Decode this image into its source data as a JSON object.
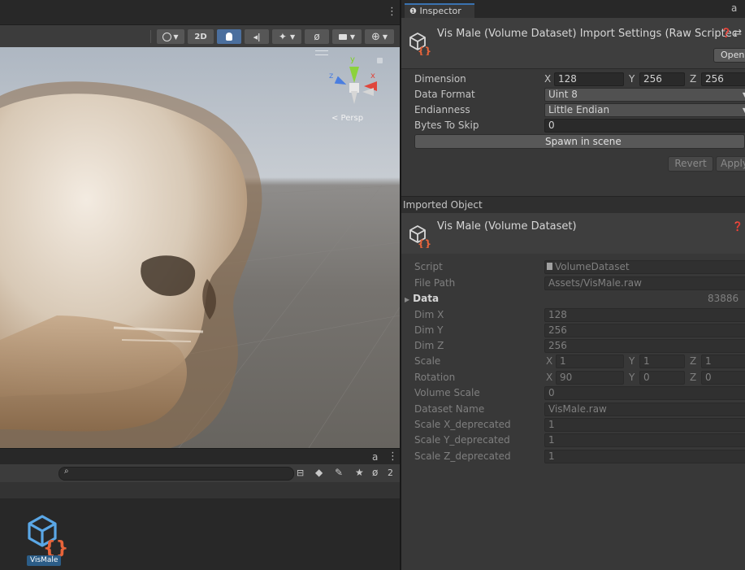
{
  "scene": {
    "toolbar": {
      "mode_2d": "2D"
    },
    "gizmo": {
      "axis_y": "y",
      "axis_z": "z",
      "axis_x": "x",
      "persp": "< Persp"
    }
  },
  "project": {
    "search": {
      "value": ""
    },
    "hidden_count": "2",
    "asset": {
      "name": "VisMale"
    }
  },
  "inspector": {
    "tab_label": "Inspector",
    "header": {
      "title": "Vis Male (Volume Dataset) Import Settings (Raw Scriptec",
      "open_label": "Open"
    },
    "settings": {
      "dimension": {
        "label": "Dimension",
        "x_label": "X",
        "x": "128",
        "y_label": "Y",
        "y": "256",
        "z_label": "Z",
        "z": "256"
      },
      "data_format": {
        "label": "Data Format",
        "value": "Uint 8"
      },
      "endianness": {
        "label": "Endianness",
        "value": "Little Endian"
      },
      "bytes_to_skip": {
        "label": "Bytes To Skip",
        "value": "0"
      },
      "spawn_label": "Spawn in scene",
      "revert_label": "Revert",
      "apply_label": "Apply"
    },
    "imported_header": "Imported Object",
    "object": {
      "title": "Vis Male (Volume Dataset)",
      "props": {
        "script": {
          "label": "Script",
          "value": "VolumeDataset"
        },
        "file_path": {
          "label": "File Path",
          "value": "Assets/VisMale.raw"
        },
        "data": {
          "label": "Data",
          "value": "83886"
        },
        "dim_x": {
          "label": "Dim X",
          "value": "128"
        },
        "dim_y": {
          "label": "Dim Y",
          "value": "256"
        },
        "dim_z": {
          "label": "Dim Z",
          "value": "256"
        },
        "scale": {
          "label": "Scale",
          "x": "1",
          "y": "1",
          "z": "1"
        },
        "rotation": {
          "label": "Rotation",
          "x": "90",
          "y": "0",
          "z": "0"
        },
        "volume_scale": {
          "label": "Volume Scale",
          "value": "0"
        },
        "dataset_name": {
          "label": "Dataset Name",
          "value": "VisMale.raw"
        },
        "scale_x_dep": {
          "label": "Scale X_deprecated",
          "value": "1"
        },
        "scale_y_dep": {
          "label": "Scale Y_deprecated",
          "value": "1"
        },
        "scale_z_dep": {
          "label": "Scale Z_deprecated",
          "value": "1"
        }
      },
      "axis_labels": {
        "x": "X",
        "y": "Y",
        "z": "Z"
      }
    }
  },
  "colors": {
    "accent_blue": "#3a72b0",
    "asset_icon_blue": "#5aa7e6",
    "asset_icon_orange": "#e8643a",
    "gizmo_y": "#8cd23c",
    "gizmo_x": "#e0463c",
    "gizmo_z": "#4a7ee0"
  }
}
